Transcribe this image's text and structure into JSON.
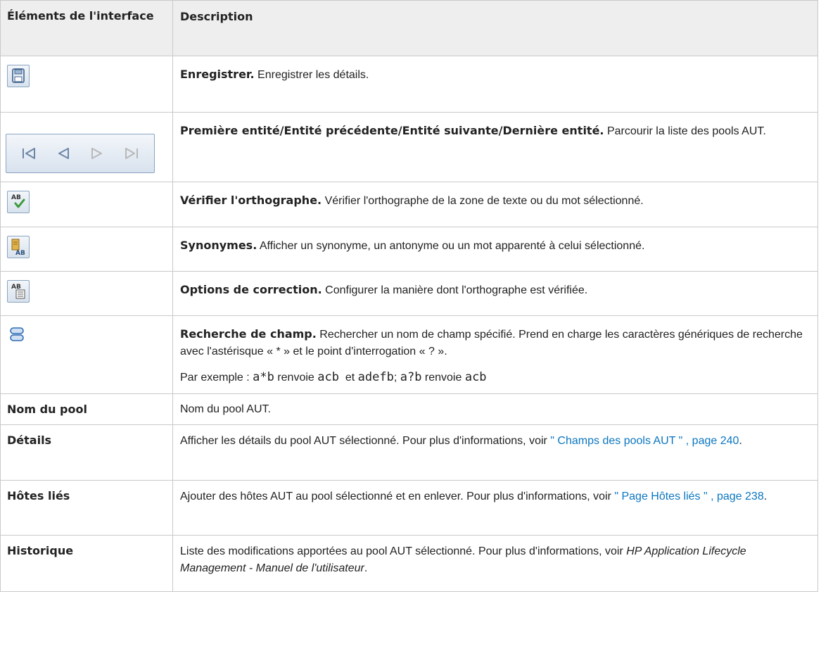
{
  "header": {
    "col1": "Éléments de l'interface",
    "col2": "Description"
  },
  "rows": [
    {
      "icon": "save-icon",
      "title": "Enregistrer.",
      "desc": " Enregistrer les détails."
    },
    {
      "icon": "navigation-arrows-icon",
      "title": "Première entité/Entité précédente/Entité suivante/Dernière entité.",
      "desc": " Parcourir la liste des pools AUT."
    },
    {
      "icon": "spell-check-icon",
      "title": "Vérifier l'orthographe.",
      "desc": " Vérifier l'orthographe de la zone de texte ou du mot sélectionné."
    },
    {
      "icon": "thesaurus-icon",
      "title": "Synonymes.",
      "desc": " Afficher un synonyme, un antonyme ou un mot apparenté à celui sélectionné."
    },
    {
      "icon": "spelling-options-icon",
      "title": "Options de correction.",
      "desc": " Configurer la manière dont l'orthographe est vérifiée."
    },
    {
      "icon": "field-search-icon",
      "title": "Recherche de champ.",
      "desc": " Rechercher un nom de champ spécifié. Prend en charge les caractères génériques de recherche avec l'astérisque « * » et le point d'interrogation « ? ».",
      "example": {
        "lead": "Par exemple : ",
        "code1": "a*b",
        "t1": " renvoie ",
        "code2": "acb",
        "t2": "  et ",
        "code3": "adefb",
        "t3": "; ",
        "code4": "a?b",
        "t4": " renvoie ",
        "code5": "acb"
      }
    },
    {
      "label": "Nom du pool",
      "desc": "Nom du pool AUT."
    },
    {
      "label": "Détails",
      "desc": "Afficher les détails du pool AUT sélectionné. Pour plus d'informations, voir ",
      "link": "\" Champs des pools AUT \" , page 240",
      "after": "."
    },
    {
      "label": "Hôtes liés",
      "desc": "Ajouter des hôtes AUT au pool sélectionné et en enlever. Pour plus d'informations, voir ",
      "link": "\" Page Hôtes liés \" , page 238",
      "after": "."
    },
    {
      "label": "Historique",
      "desc": "Liste des modifications apportées au pool AUT sélectionné. Pour plus d'informations, voir ",
      "ital": "HP Application Lifecycle Management - Manuel de l'utilisateur",
      "after": "."
    }
  ],
  "colors": {
    "link": "#0b76c0",
    "header_bg": "#eeeeee",
    "border": "#c9c9c9"
  }
}
